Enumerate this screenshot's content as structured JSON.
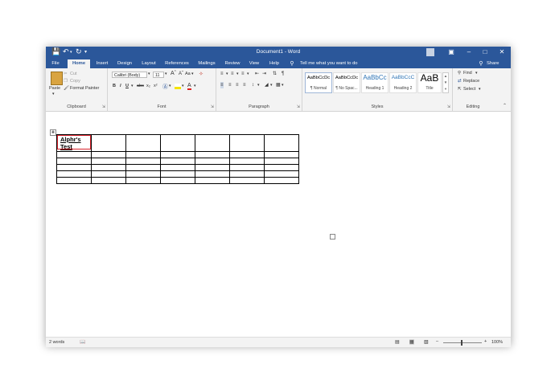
{
  "window": {
    "title": "Document1 - Word"
  },
  "tabs": [
    "File",
    "Home",
    "Insert",
    "Design",
    "Layout",
    "References",
    "Mailings",
    "Review",
    "View",
    "Help"
  ],
  "tell_me": "Tell me what you want to do",
  "share": "Share",
  "clipboard": {
    "paste": "Paste",
    "cut": "Cut",
    "copy": "Copy",
    "format_painter": "Format Painter",
    "label": "Clipboard"
  },
  "font": {
    "name": "Calibri (Body)",
    "size": "11",
    "label": "Font",
    "case": "Aa"
  },
  "paragraph": {
    "label": "Paragraph"
  },
  "styles": {
    "label": "Styles",
    "items": [
      {
        "preview": "AaBbCcDc",
        "name": "¶ Normal"
      },
      {
        "preview": "AaBbCcDc",
        "name": "¶ No Spac..."
      },
      {
        "preview": "AaBbCc",
        "name": "Heading 1"
      },
      {
        "preview": "AaBbCcC",
        "name": "Heading 2"
      },
      {
        "preview": "AaB",
        "name": "Title"
      }
    ]
  },
  "editing": {
    "find": "Find",
    "replace": "Replace",
    "select": "Select",
    "label": "Editing"
  },
  "document": {
    "cell_text_line1": "Alphr's",
    "cell_text_line2": "Test"
  },
  "status": {
    "words": "2 words",
    "zoom": "100%"
  },
  "colors": {
    "accent": "#2b579a",
    "highlight_box": "#d9232d"
  }
}
